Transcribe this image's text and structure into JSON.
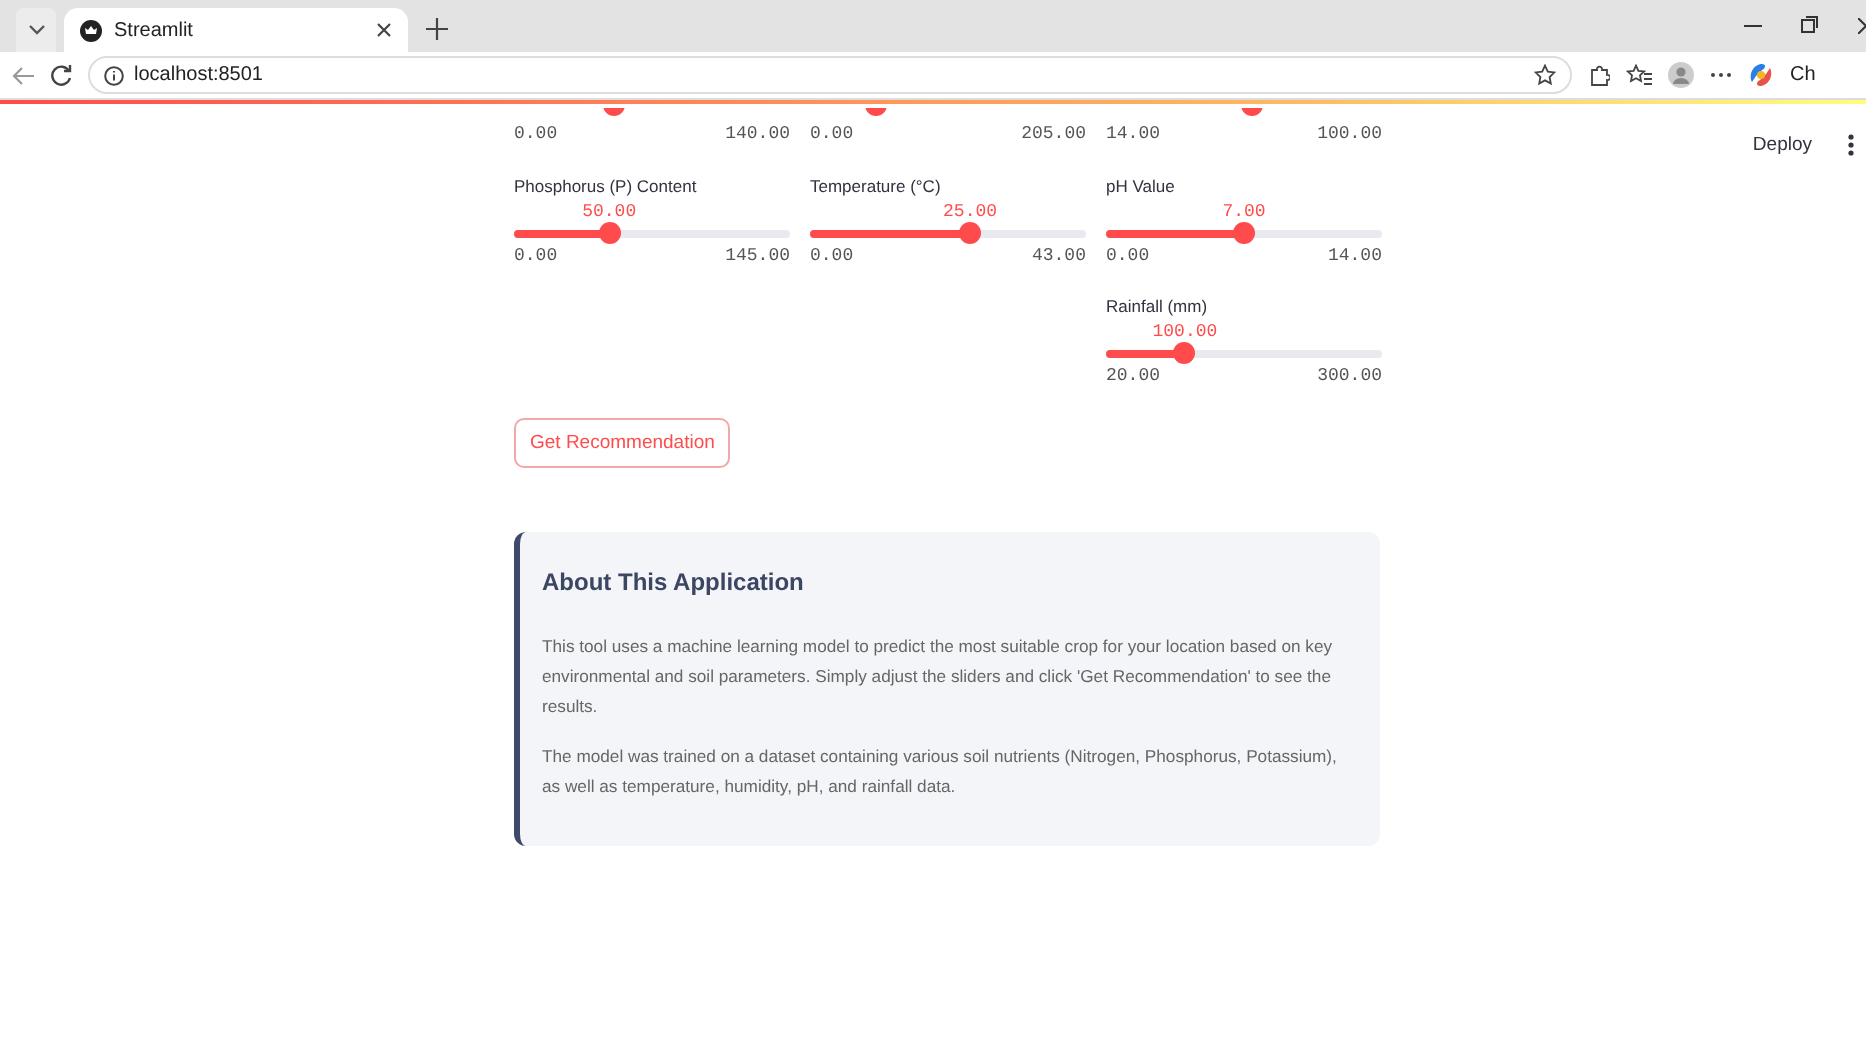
{
  "browser": {
    "tab_title": "Streamlit",
    "url": "localhost:8501",
    "sidebar_button": "Ch"
  },
  "header": {
    "deploy": "Deploy"
  },
  "slider_rows": [
    {
      "cells": [
        {
          "kind": "cut",
          "min": "0.00",
          "max": "140.00",
          "level": 0.36
        },
        {
          "kind": "cut",
          "min": "0.00",
          "max": "205.00",
          "level": 0.24
        },
        {
          "kind": "cut",
          "min": "14.00",
          "max": "100.00",
          "level": 0.53
        }
      ]
    },
    {
      "cells": [
        {
          "kind": "slider",
          "label": "Phosphorus (P) Content",
          "value": "50.00",
          "min": "0.00",
          "max": "145.00",
          "level": 0.345
        },
        {
          "kind": "slider",
          "label": "Temperature (°C)",
          "value": "25.00",
          "min": "0.00",
          "max": "43.00",
          "level": 0.58
        },
        {
          "kind": "slider",
          "label": "pH Value",
          "value": "7.00",
          "min": "0.00",
          "max": "14.00",
          "level": 0.5
        }
      ]
    },
    {
      "cells": [
        {
          "kind": "empty"
        },
        {
          "kind": "empty"
        },
        {
          "kind": "slider",
          "label": "Rainfall (mm)",
          "value": "100.00",
          "min": "20.00",
          "max": "300.00",
          "level": 0.286
        }
      ]
    }
  ],
  "button": "Get Recommendation",
  "info": {
    "title": "About This Application",
    "paragraphs": [
      "This tool uses a machine learning model to predict the most suitable crop for your location based on key environmental and soil parameters. Simply adjust the sliders and click 'Get Recommendation' to see the results.",
      "The model was trained on a dataset containing various soil nutrients (Nitrogen, Phosphorus, Potassium), as well as temperature, humidity, pH, and rainfall data."
    ]
  }
}
